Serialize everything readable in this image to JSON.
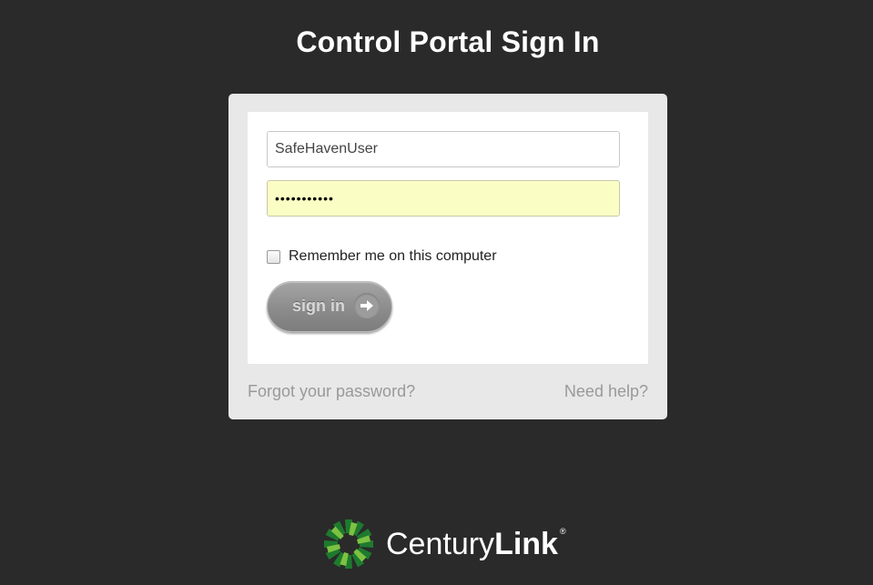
{
  "page": {
    "title": "Control Portal Sign In"
  },
  "form": {
    "username_value": "SafeHavenUser",
    "password_value": "•••••••••••",
    "remember_label": "Remember me on this computer",
    "remember_checked": false,
    "signin_label": "sign in",
    "signin_icon": "arrow-right-icon"
  },
  "links": {
    "forgot": "Forgot your password?",
    "help": "Need help?"
  },
  "brand": {
    "name_light": "Century",
    "name_bold": "Link",
    "reg_mark": "®",
    "logo_icon": "centurylink-burst-icon",
    "colors": {
      "green_dark": "#1e7a2e",
      "green_light": "#7cc242"
    }
  },
  "colors": {
    "background": "#2a2a2a",
    "card": "#e8e8e8",
    "password_autofill": "#fafdc4",
    "link_text": "#999999"
  }
}
